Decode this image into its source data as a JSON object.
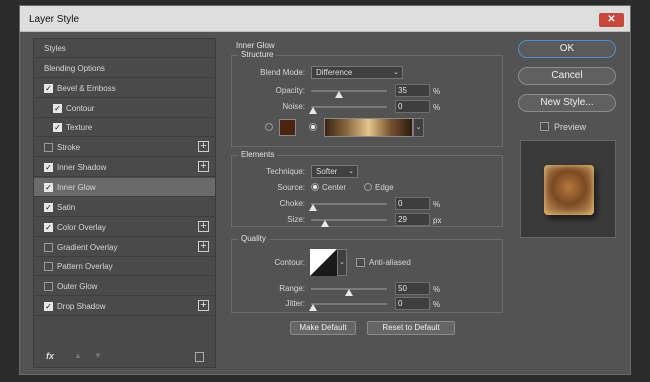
{
  "window": {
    "title": "Layer Style",
    "close_icon": "close-icon"
  },
  "left_panel": {
    "items": [
      {
        "label": "Styles",
        "checkbox": false,
        "plus": false,
        "indent": false,
        "selected": false
      },
      {
        "label": "Blending Options",
        "checkbox": false,
        "plus": false,
        "indent": false,
        "selected": false
      },
      {
        "label": "Bevel & Emboss",
        "checkbox": true,
        "checked": true,
        "plus": false,
        "indent": false,
        "selected": false
      },
      {
        "label": "Contour",
        "checkbox": true,
        "checked": true,
        "plus": false,
        "indent": true,
        "selected": false
      },
      {
        "label": "Texture",
        "checkbox": true,
        "checked": true,
        "plus": false,
        "indent": true,
        "selected": false
      },
      {
        "label": "Stroke",
        "checkbox": true,
        "checked": false,
        "plus": true,
        "indent": false,
        "selected": false
      },
      {
        "label": "Inner Shadow",
        "checkbox": true,
        "checked": true,
        "plus": true,
        "indent": false,
        "selected": false
      },
      {
        "label": "Inner Glow",
        "checkbox": true,
        "checked": true,
        "plus": false,
        "indent": false,
        "selected": true
      },
      {
        "label": "Satin",
        "checkbox": true,
        "checked": true,
        "plus": false,
        "indent": false,
        "selected": false
      },
      {
        "label": "Color Overlay",
        "checkbox": true,
        "checked": true,
        "plus": true,
        "indent": false,
        "selected": false
      },
      {
        "label": "Gradient Overlay",
        "checkbox": true,
        "checked": false,
        "plus": true,
        "indent": false,
        "selected": false
      },
      {
        "label": "Pattern Overlay",
        "checkbox": true,
        "checked": false,
        "plus": false,
        "indent": false,
        "selected": false
      },
      {
        "label": "Outer Glow",
        "checkbox": true,
        "checked": false,
        "plus": false,
        "indent": false,
        "selected": false
      },
      {
        "label": "Drop Shadow",
        "checkbox": true,
        "checked": true,
        "plus": true,
        "indent": false,
        "selected": false
      }
    ],
    "bottom": {
      "fx_label": "fx",
      "up_icon": "move-up-icon",
      "down_icon": "move-down-icon",
      "trash_icon": "trash-icon"
    }
  },
  "inner_glow": {
    "title": "Inner Glow",
    "structure": {
      "title": "Structure",
      "blend_mode_label": "Blend Mode:",
      "blend_mode_value": "Difference",
      "opacity_label": "Opacity:",
      "opacity_value": "35",
      "opacity_unit": "%",
      "noise_label": "Noise:",
      "noise_value": "0",
      "noise_unit": "%",
      "glow_color": "#4a2411",
      "gradient_colors": [
        "#3a2414",
        "#8c6a40",
        "#e1c58a",
        "#7a5430",
        "#2e1a10"
      ]
    },
    "elements": {
      "title": "Elements",
      "technique_label": "Technique:",
      "technique_value": "Softer",
      "source_label": "Source:",
      "source_center": "Center",
      "source_edge": "Edge",
      "choke_label": "Choke:",
      "choke_value": "0",
      "choke_unit": "%",
      "size_label": "Size:",
      "size_value": "29",
      "size_unit": "px"
    },
    "quality": {
      "title": "Quality",
      "contour_label": "Contour:",
      "anti_aliased_label": "Anti-aliased",
      "range_label": "Range:",
      "range_value": "50",
      "range_unit": "%",
      "jitter_label": "Jitter:",
      "jitter_value": "0",
      "jitter_unit": "%"
    },
    "make_default_label": "Make Default",
    "reset_default_label": "Reset to Default"
  },
  "right_panel": {
    "ok_label": "OK",
    "cancel_label": "Cancel",
    "new_style_label": "New Style...",
    "preview_label": "Preview",
    "preview_checked": false
  }
}
